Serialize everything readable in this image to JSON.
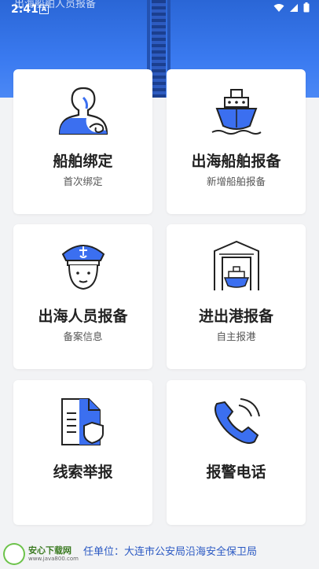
{
  "statusbar": {
    "time": "2:41",
    "a_badge": "A"
  },
  "hero": {
    "faded_title": "出海船舶人员报备"
  },
  "cards": [
    {
      "title": "船舶绑定",
      "subtitle": "首次绑定",
      "icon": "person-icon"
    },
    {
      "title": "出海船舶报备",
      "subtitle": "新增船舶报备",
      "icon": "ship-icon"
    },
    {
      "title": "出海人员报备",
      "subtitle": "备案信息",
      "icon": "sailor-icon"
    },
    {
      "title": "进出港报备",
      "subtitle": "自主报港",
      "icon": "harbor-icon"
    },
    {
      "title": "线索举报",
      "subtitle": "",
      "icon": "report-document-icon"
    },
    {
      "title": "报警电话",
      "subtitle": "",
      "icon": "phone-icon"
    }
  ],
  "footer": {
    "unit_text": "任单位：大连市公安局沿海安全保卫局",
    "watermark_name": "安心下载网",
    "watermark_url": "www.java800.com"
  },
  "colors": {
    "accent": "#3b6ff0",
    "hero_blue": "#3a7af0",
    "footer_text": "#2b59c3"
  }
}
